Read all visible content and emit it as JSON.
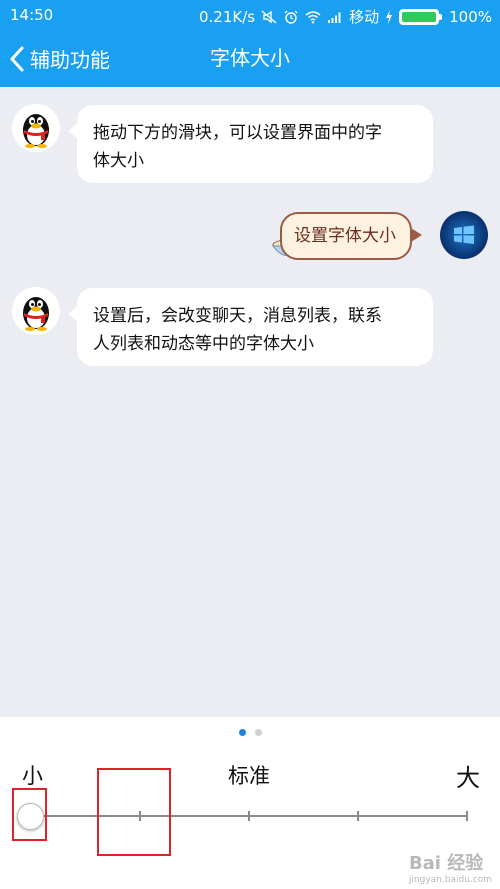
{
  "status_bar": {
    "time": "14:50",
    "speed": "0.21K/s",
    "carrier": "移动",
    "battery": "100%",
    "battery_level": 1.0,
    "icons": [
      "no-sound-icon",
      "alarm-icon",
      "wifi-icon",
      "signal-icon",
      "charging-icon",
      "battery-icon"
    ]
  },
  "header": {
    "back_label": "辅助功能",
    "title": "字体大小"
  },
  "messages": [
    {
      "sender": "qq-penguin",
      "text_line1": "拖动下方的滑块，可以设置界面中的字",
      "text_line2": "体大小"
    },
    {
      "sender": "user",
      "text": "设置字体大小"
    },
    {
      "sender": "qq-penguin",
      "text_line1": "设置后，会改变聊天，消息列表，联系",
      "text_line2": "人列表和动态等中的字体大小"
    }
  ],
  "slider": {
    "label_small": "小",
    "label_standard": "标准",
    "label_large": "大",
    "steps": 5,
    "selected_step": 0
  },
  "pager": {
    "pages": 2,
    "active": 0
  },
  "watermark": {
    "brand": "Bai 经验",
    "url": "jingyan.baidu.com"
  },
  "colors": {
    "accent": "#1aa0f0",
    "highlight_box": "#e0222b",
    "my_bubble_bg": "#fdf1df",
    "my_bubble_border": "#9c5b45"
  }
}
